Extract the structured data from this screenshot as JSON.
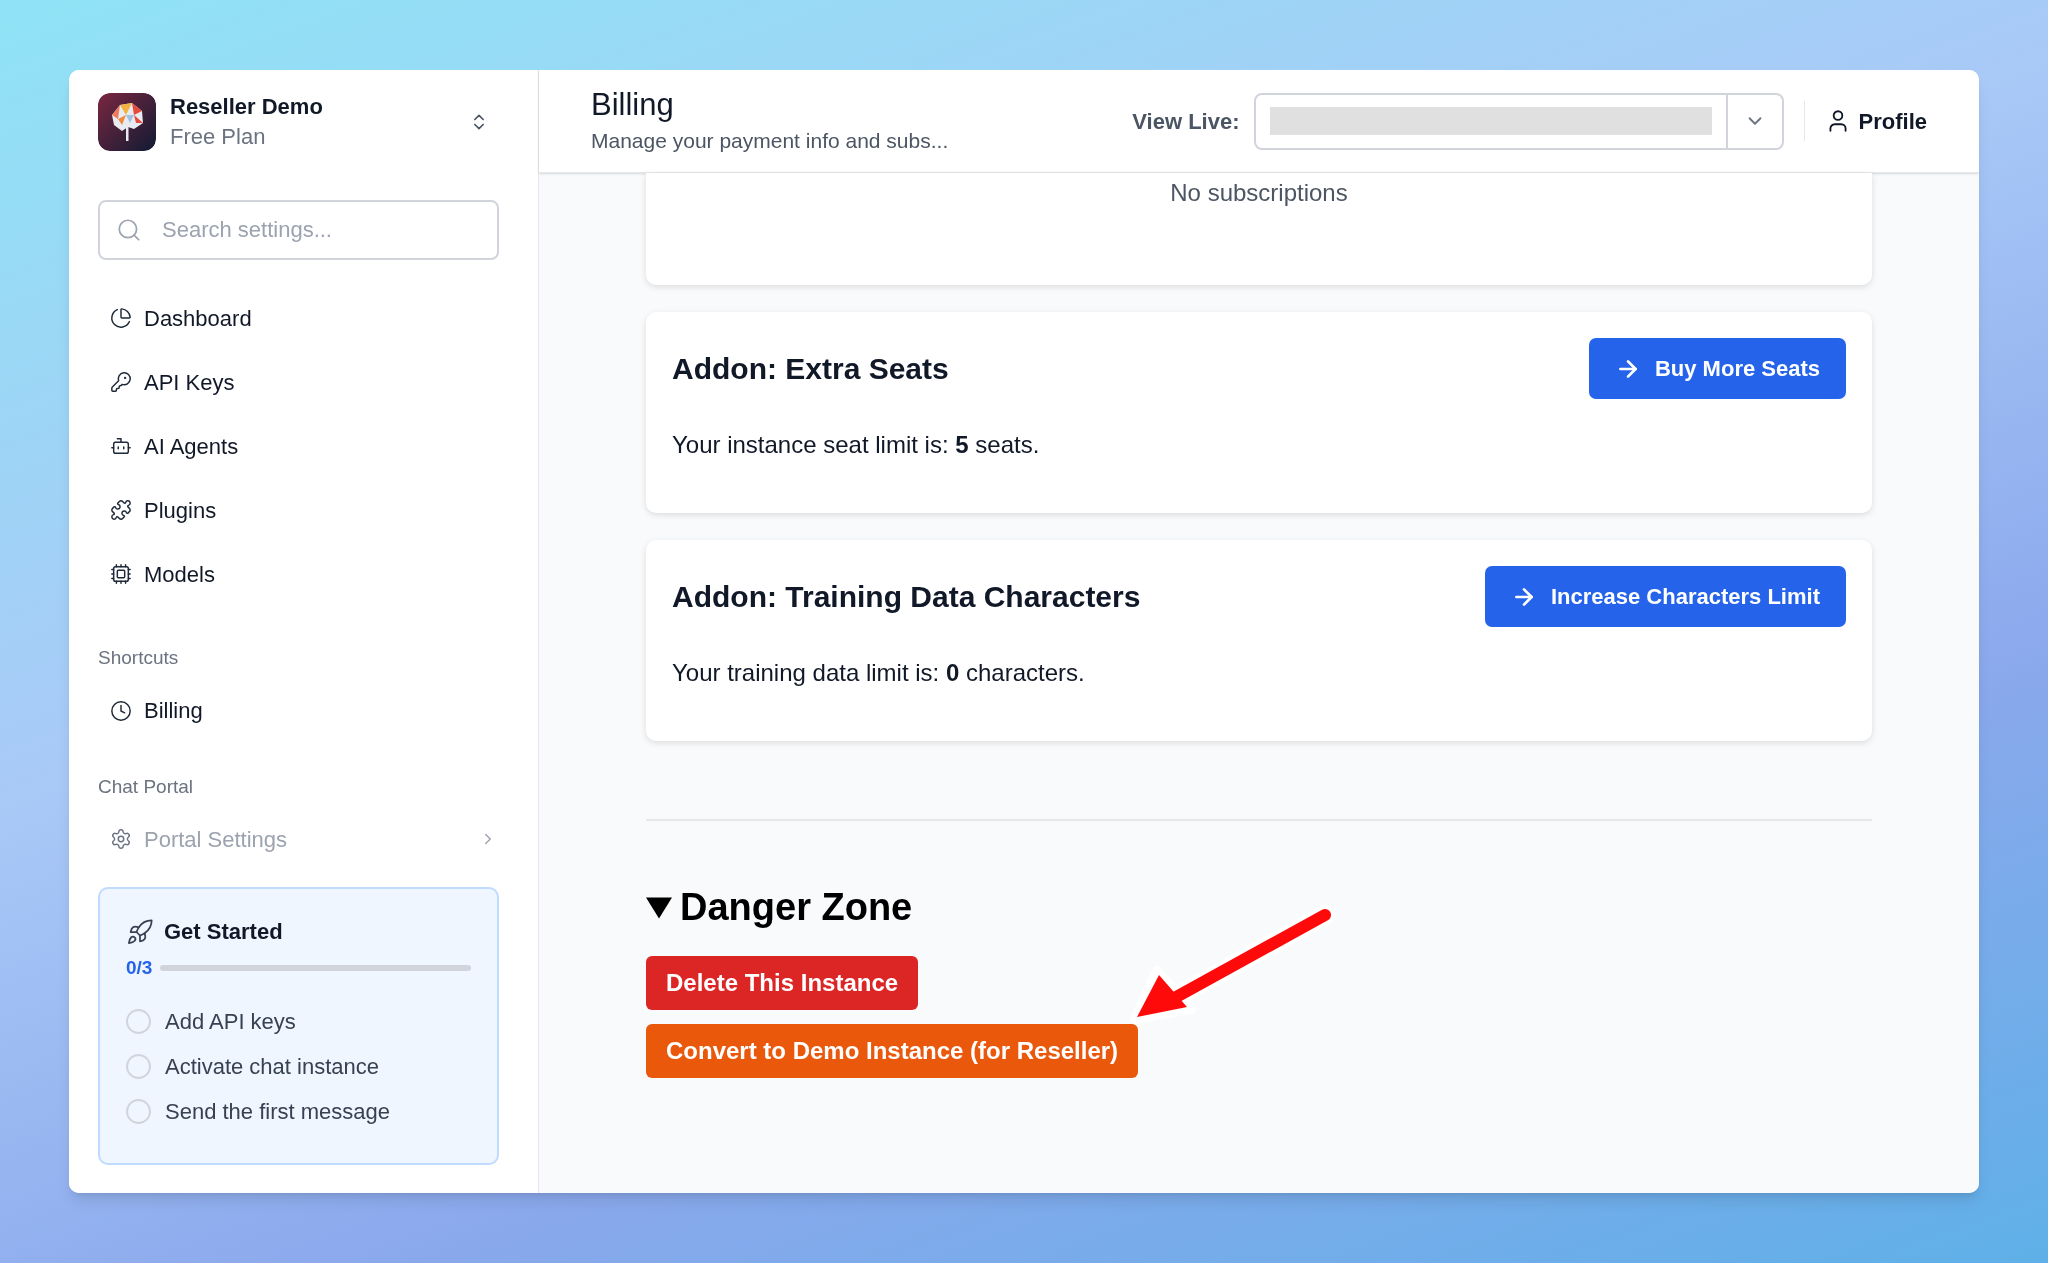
{
  "workspace": {
    "name": "Reseller Demo",
    "plan": "Free Plan"
  },
  "search": {
    "placeholder": "Search settings..."
  },
  "nav": [
    {
      "label": "Dashboard",
      "kind": "pie",
      "selected": false
    },
    {
      "label": "API Keys",
      "kind": "key",
      "selected": false
    },
    {
      "label": "AI Agents",
      "kind": "agent",
      "selected": false
    },
    {
      "label": "Plugins",
      "kind": "puzzle",
      "selected": false
    },
    {
      "label": "Models",
      "kind": "chip",
      "selected": false
    }
  ],
  "sections": [
    {
      "title": "Shortcuts",
      "items": [
        {
          "label": "Billing",
          "kind": "clock",
          "disabled": false,
          "chevron": false
        }
      ]
    },
    {
      "title": "Chat Portal",
      "items": [
        {
          "label": "Portal Settings",
          "kind": "gear",
          "disabled": true,
          "chevron": true
        }
      ]
    }
  ],
  "get_started": {
    "title": "Get Started",
    "count": "0/3",
    "level": 0,
    "steps": [
      {
        "label": "Add API keys",
        "checked": false
      },
      {
        "label": "Activate chat instance",
        "checked": false
      },
      {
        "label": "Send the first message",
        "checked": false
      }
    ]
  },
  "header": {
    "title": "Billing",
    "subtitle": "Manage your payment info and subs...",
    "view_live_label": "View Live:",
    "profile": "Profile"
  },
  "subscriptions": {
    "empty_text": "No subscriptions"
  },
  "addons": [
    {
      "title": "Addon: Extra Seats",
      "button": "Buy More Seats",
      "text": "Your instance seat limit is: **5** seats."
    },
    {
      "title": "Addon: Training Data Characters",
      "button": "Increase Characters Limit",
      "text": "Your training data limit is: **0** characters."
    }
  ],
  "danger_zone": {
    "title": "Danger Zone",
    "expanded": true,
    "buttons": [
      {
        "label": "Delete This Instance",
        "kind": "delete"
      },
      {
        "label": "Convert to Demo Instance (for Reseller)",
        "kind": "convert"
      }
    ]
  },
  "callout": {
    "kind": "arrow"
  }
}
